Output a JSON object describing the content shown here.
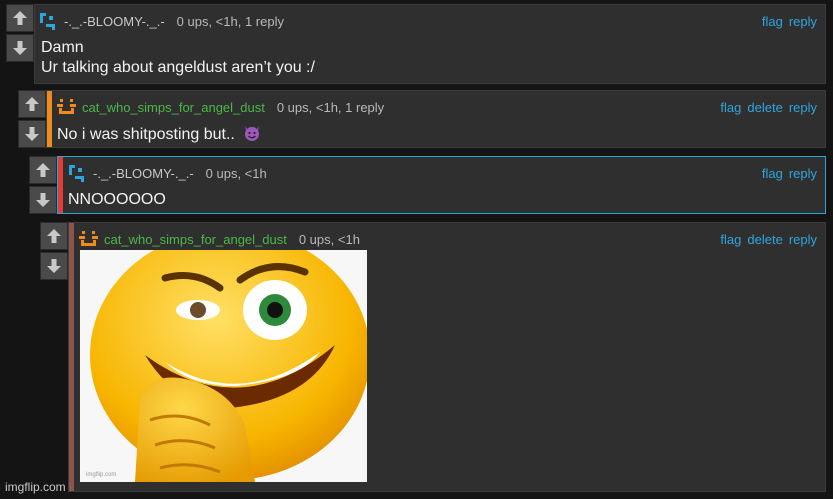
{
  "vote": {
    "up_icon": "arrow-up-icon",
    "down_icon": "arrow-down-icon"
  },
  "colors": {
    "link": "#2ea6dd",
    "green_user": "#4cb849",
    "orange_stripe": "#f08a1c",
    "red_stripe": "#e23b3b",
    "brown_stripe": "#8c5549",
    "highlight_border": "#2aa7d6"
  },
  "comments": [
    {
      "username": "-._.-BLOOMY-._.-",
      "meta": "0 ups, <1h, 1 reply",
      "actions": [
        "flag",
        "reply"
      ],
      "lines": [
        "Damn",
        "Ur talking about angeldust aren’t you :/"
      ]
    },
    {
      "username": "cat_who_simps_for_angel_dust",
      "meta": "0 ups, <1h, 1 reply",
      "actions": [
        "flag",
        "delete",
        "reply"
      ],
      "text": "No i was shitposting but.."
    },
    {
      "username": "-._.-BLOOMY-._.-",
      "meta": "0 ups, <1h",
      "actions": [
        "flag",
        "reply"
      ],
      "text": "NNOOOOOO"
    },
    {
      "username": "cat_who_simps_for_angel_dust",
      "meta": "0 ups, <1h",
      "actions": [
        "flag",
        "delete",
        "reply"
      ],
      "image_watermark": "imgflip.com"
    }
  ],
  "footer_watermark": "imgflip.com"
}
